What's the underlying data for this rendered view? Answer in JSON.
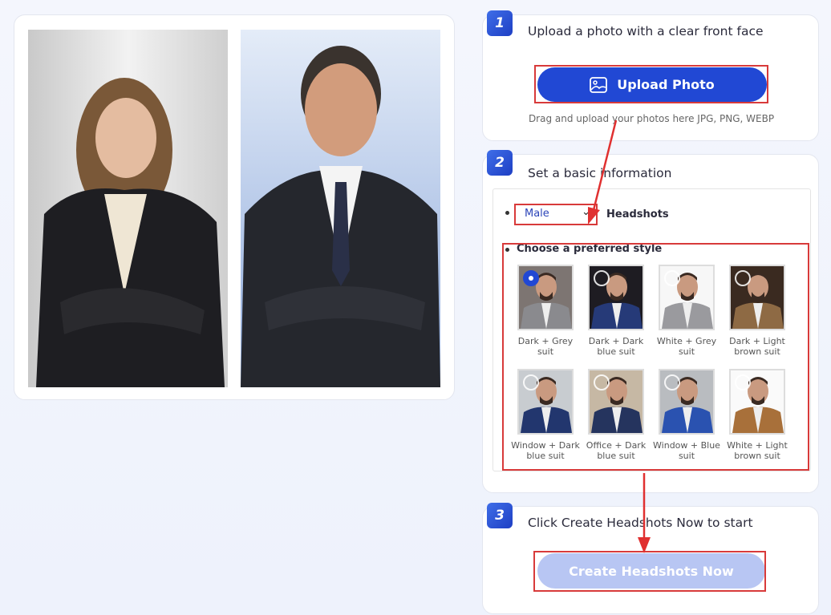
{
  "step1": {
    "number": "1",
    "title": "Upload a photo with a clear front face",
    "button": "Upload Photo",
    "hint": "Drag and upload your photos here JPG, PNG, WEBP"
  },
  "step2": {
    "number": "2",
    "title": "Set a basic information",
    "gender": "Male",
    "headshots_label": "Headshots",
    "style_label": "Choose a preferred style",
    "styles": [
      {
        "label": "Dark + Grey suit",
        "selected": true,
        "bg": "#7d7572",
        "suit": "#8a8a8e"
      },
      {
        "label": "Dark + Dark blue suit",
        "selected": false,
        "bg": "#1e1c22",
        "suit": "#263a78"
      },
      {
        "label": "White + Grey suit",
        "selected": false,
        "bg": "#f7f7f7",
        "suit": "#9a9a9e"
      },
      {
        "label": "Dark + Light brown suit",
        "selected": false,
        "bg": "#3a2a20",
        "suit": "#8e6a44"
      },
      {
        "label": "Window + Dark blue suit",
        "selected": false,
        "bg": "#c8ccd0",
        "suit": "#22366e"
      },
      {
        "label": "Office + Dark blue suit",
        "selected": false,
        "bg": "#c6b8a4",
        "suit": "#25345e"
      },
      {
        "label": "Window + Blue suit",
        "selected": false,
        "bg": "#b9bcc0",
        "suit": "#2a52b0"
      },
      {
        "label": "White + Light brown suit",
        "selected": false,
        "bg": "#fafafa",
        "suit": "#a8703a"
      }
    ]
  },
  "step3": {
    "number": "3",
    "title": "Click Create Headshots Now to start",
    "button": "Create Headshots Now"
  },
  "colors": {
    "primary": "#2148d4",
    "disabled": "#b8c6f3",
    "annotation": "#d83a3a"
  }
}
